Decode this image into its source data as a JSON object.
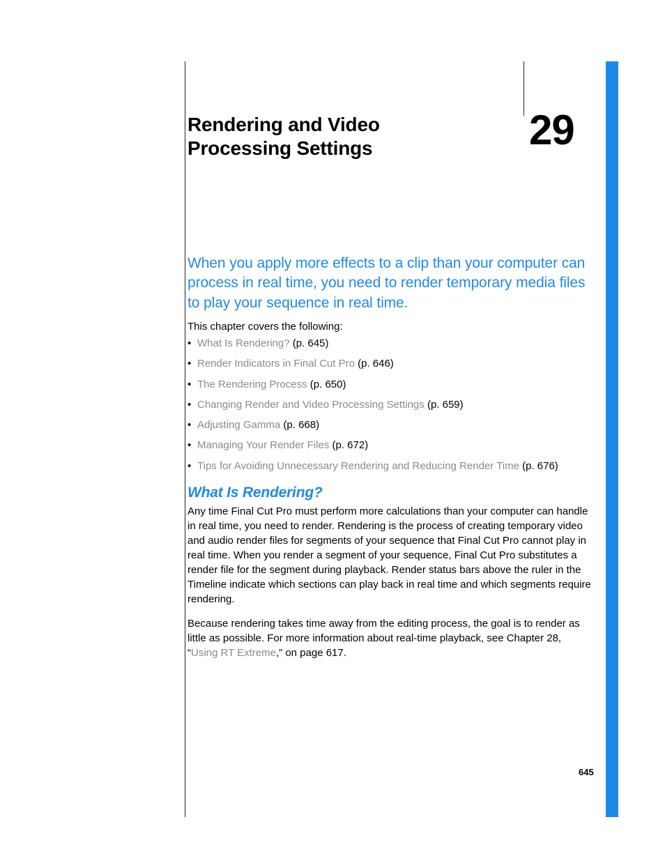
{
  "chapter": {
    "title": "Rendering and Video Processing Settings",
    "number": "29"
  },
  "intro": "When you apply more effects to a clip than your computer can process in real time, you need to render temporary media files to play your sequence in real time.",
  "covers_lead": "This chapter covers the following:",
  "toc": [
    {
      "label": "What Is Rendering?",
      "page": "(p. 645)"
    },
    {
      "label": "Render Indicators in Final Cut Pro",
      "page": "(p. 646)"
    },
    {
      "label": "The Rendering Process",
      "page": "(p. 650)"
    },
    {
      "label": "Changing Render and Video Processing Settings",
      "page": "(p. 659)"
    },
    {
      "label": "Adjusting Gamma",
      "page": "(p. 668)"
    },
    {
      "label": "Managing Your Render Files",
      "page": "(p. 672)"
    },
    {
      "label": "Tips for Avoiding Unnecessary Rendering and Reducing Render Time",
      "page": "(p. 676)"
    }
  ],
  "section": {
    "heading": "What Is Rendering?",
    "para1": "Any time Final Cut Pro must perform more calculations than your computer can handle in real time, you need to render. Rendering is the process of creating temporary video and audio render files for segments of your sequence that Final Cut Pro cannot play in real time. When you render a segment of your sequence, Final Cut Pro substitutes a render file for the segment during playback. Render status bars above the ruler in the Timeline indicate which sections can play back in real time and which segments require rendering.",
    "para2_a": "Because rendering takes time away from the editing process, the goal is to render as little as possible. For more information about real-time playback, see Chapter 28, “",
    "para2_link": "Using RT Extreme",
    "para2_b": ",” on page 617."
  },
  "page_number": "645"
}
